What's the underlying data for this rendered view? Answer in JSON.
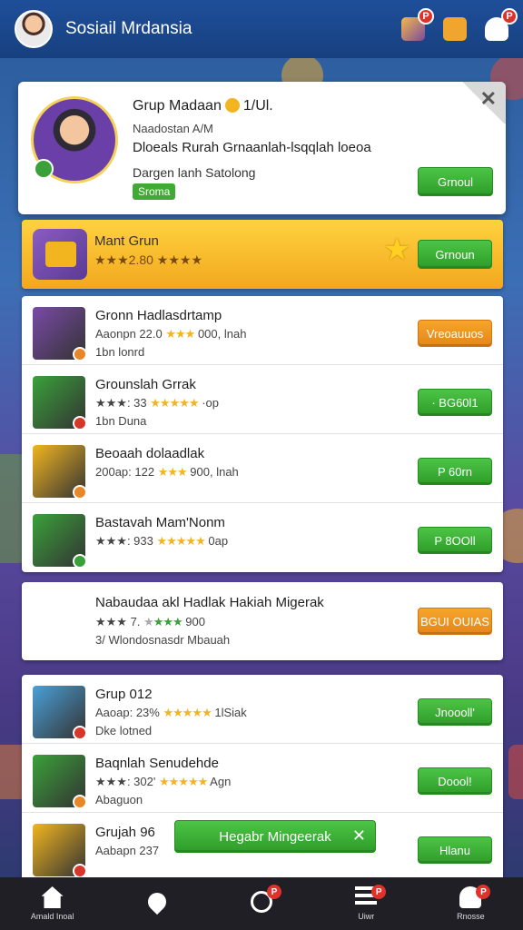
{
  "app": {
    "title": "Sosiail Mrdansia"
  },
  "topbar": {
    "badges": {
      "game": "P",
      "person": "P"
    }
  },
  "profile": {
    "title": "Grup Madaan",
    "title_suffix": "1/Ul.",
    "subtitle": "Naadostan A/M",
    "description": "Dloeals Rurah Grnaanlah-lsqqlah loeoa",
    "info": "Dargen lanh Satolong",
    "tag": "Sroma",
    "join_label": "Grnoul"
  },
  "featured": {
    "title": "Mant Grun",
    "stars_text": "★★★2.80 ★★★★",
    "button_label": "Grnoun"
  },
  "list_a": [
    {
      "title": "Gronn Hadlasdrtamp",
      "stats_prefix": "Aaonpn 22.0",
      "stars": "★★★",
      "stats_suffix": "000, lnah",
      "meta": "1bn lonrd",
      "button": "Vreoauuos",
      "button_color": "orange",
      "thumb_color": "#7a4aa8",
      "mini_color": "#e8862a"
    },
    {
      "title": "Grounslah Grrak",
      "stats_prefix": "★★★: 33",
      "stars": "★★★★★",
      "stats_suffix": "·op",
      "meta": "1bn Duna",
      "button": "· BG60l1",
      "button_color": "green",
      "thumb_color": "#3aa13a",
      "mini_color": "#d7362a"
    },
    {
      "title": "Beoaah dolaadlak",
      "stats_prefix": "200ap: 122",
      "stars": "★★★",
      "stats_suffix": "900, lnah",
      "meta": "",
      "button": "P 60rn",
      "button_color": "green",
      "thumb_color": "#f2b51f",
      "mini_color": "#e8862a"
    },
    {
      "title": "Bastavah Mam'Nonm",
      "stats_prefix": "★★★: 933",
      "stars": "★★★★★",
      "stats_suffix": "0ap",
      "meta": "",
      "button": "P 8OOll",
      "button_color": "green",
      "thumb_color": "#3aa13a",
      "mini_color": "#3aa13a"
    }
  ],
  "single": {
    "title": "Nabaudaa akl Hadlak Hakiah Migerak",
    "stats_prefix": "★★★ 7.",
    "stars": "★★★",
    "stats_suffix": "900",
    "meta": "3/ Wlondosnasdr Mbauah",
    "button": "BGUI OUIAS",
    "thumb_color": "#7a4aa8"
  },
  "list_b": [
    {
      "title": "Grup 012",
      "stats_prefix": "Aaoap: 23%",
      "stars": "★★★★★",
      "stats_suffix": "1lSiak",
      "meta": "Dke lotned",
      "button": "Jnoooll'",
      "thumb_color": "#4aa0d8",
      "mini_color": "#d7362a"
    },
    {
      "title": "Baqnlah Senudehde",
      "stats_prefix": "★★★: 302'",
      "stars": "★★★★★",
      "stats_suffix": "Agn",
      "meta": "Abaguon",
      "button": "Doool!",
      "thumb_color": "#3aa13a",
      "mini_color": "#e8862a"
    },
    {
      "title": "Grujah 96",
      "stats_prefix": "Aabapn 237",
      "stars": "",
      "stats_suffix": "",
      "meta": "",
      "button": "Hlanu",
      "thumb_color": "#f2b51f",
      "mini_color": "#d7362a"
    }
  ],
  "wide_button": {
    "label": "Hegabr Mingeerak"
  },
  "nav": [
    {
      "label": "Amald Inoal",
      "icon": "home-icon",
      "badge": ""
    },
    {
      "label": "",
      "icon": "pin-icon",
      "badge": ""
    },
    {
      "label": "",
      "icon": "clock-icon",
      "badge": "P"
    },
    {
      "label": "Uiwr",
      "icon": "list-icon",
      "badge": "P"
    },
    {
      "label": "Rnosse",
      "icon": "people-icon",
      "badge": "P"
    }
  ]
}
